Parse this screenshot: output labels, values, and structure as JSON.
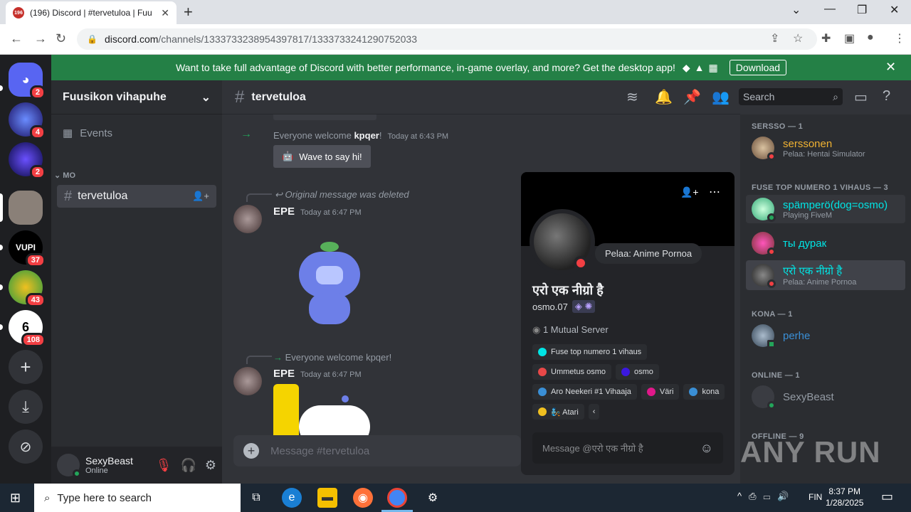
{
  "browser": {
    "tab_title": "(196) Discord | #tervetuloa | Fuu",
    "tab_badge": "196",
    "url_host": "discord.com",
    "url_path": "/channels/1333733238954397817/1333733241290752033"
  },
  "banner": {
    "text": "Want to take full advantage of Discord with better performance, in-game overlay, and more? Get the desktop app!",
    "download_label": "Download"
  },
  "rail": {
    "badges": [
      "2",
      "4",
      "2",
      "37",
      "43",
      "108"
    ]
  },
  "server": {
    "name": "Fuusikon vihapuhe",
    "events_label": "Events",
    "category": "MO",
    "channel": "tervetuloa"
  },
  "user_panel": {
    "name": "SexyBeast",
    "status": "Online"
  },
  "chat": {
    "channel": "tervetuloa",
    "search_placeholder": "Search",
    "join_text": "Everyone welcome ",
    "join_user": "kpqer",
    "join_suffix": "!",
    "join_time": "Today at 6:43 PM",
    "wave_label": "Wave to say hi!",
    "deleted_reply": "Original message was deleted",
    "msg1_author": "EPE",
    "msg1_time": "Today at 6:47 PM",
    "reply2": "Everyone welcome kpqer!",
    "msg2_author": "EPE",
    "msg2_time": "Today at 6:47 PM",
    "input_placeholder": "Message #tervetuloa"
  },
  "members": {
    "cat1": "SERSSO — 1",
    "m1_name": "serssonen",
    "m1_activity": "Pelaa: Hentai Simulator",
    "cat2": "FUSE TOP NUMERO 1 VIHAUS — 3",
    "m2_name": "spämperö(dog=osmo)",
    "m2_activity": "Playing FiveM",
    "m3_name": "ты дурак",
    "m4_name": "एरो एक नीग्रो है",
    "m4_activity": "Pelaa: Anime Pornoa",
    "cat3": "KONA — 1",
    "m5_name": "perhe",
    "cat4": "ONLINE — 1",
    "m6_name": "SexyBeast",
    "cat5": "OFFLINE — 9"
  },
  "popout": {
    "bubble": "Pelaa: Anime Pornoa",
    "display_name": "एरो एक नीग्रो है",
    "username": "osmo.07",
    "mutual": "1 Mutual Server",
    "roles": [
      {
        "label": "Fuse top numero 1 vihaus",
        "color": "#00e5e5"
      },
      {
        "label": "Ummetus osmo",
        "color": "#e84848"
      },
      {
        "label": "osmo",
        "color": "#3b18e0"
      },
      {
        "label": "Aro Neekeri #1 Vihaaja",
        "color": "#3a8fd6"
      },
      {
        "label": "Väri",
        "color": "#e0188a"
      },
      {
        "label": "kona",
        "color": "#3a8fd6"
      },
      {
        "label": "🧞 Atari",
        "color": "#f0c020"
      }
    ],
    "message_placeholder": "Message @एरो एक नीग्रो है"
  },
  "taskbar": {
    "search_placeholder": "Type here to search",
    "lang": "FIN",
    "time": "8:37 PM",
    "date": "1/28/2025"
  },
  "watermark": "ANY RUN"
}
